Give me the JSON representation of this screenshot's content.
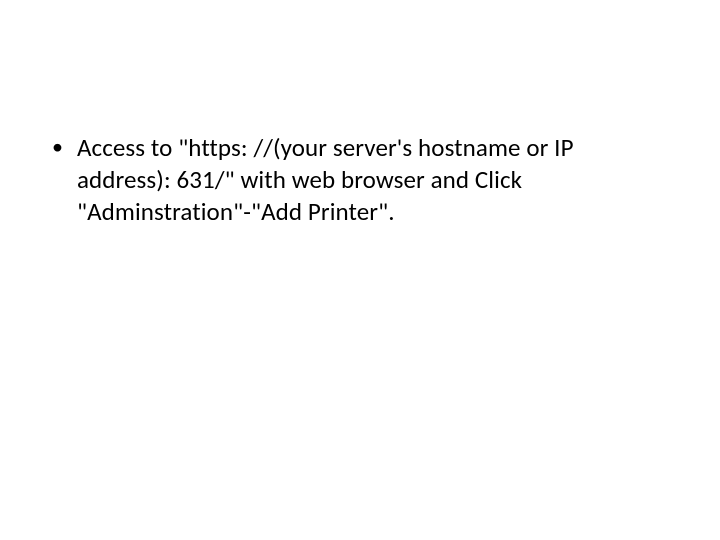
{
  "slide": {
    "bullets": [
      {
        "text": "Access to \"https: //(your server's hostname or IP address): 631/\" with web browser and Click \"Adminstration\"-\"Add Printer\"."
      }
    ]
  }
}
